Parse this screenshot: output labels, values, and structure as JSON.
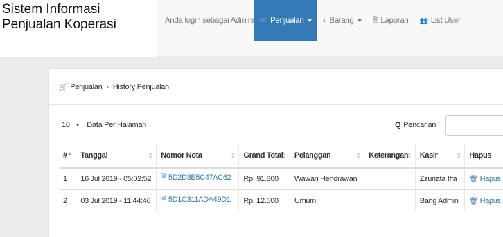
{
  "brand": "Sistem Informasi Penjualan Koperasi",
  "login_text": "Anda login sebagai Administrator",
  "menu": [
    {
      "label": "Penjualan",
      "icon": "cart-icon",
      "glyph": "🛒",
      "dropdown": true,
      "active": true
    },
    {
      "label": "Barang",
      "icon": "tag-icon",
      "glyph": "◐",
      "dropdown": true,
      "active": false
    },
    {
      "label": "Laporan",
      "icon": "file-icon",
      "glyph": "🗎",
      "dropdown": false,
      "active": false
    },
    {
      "label": "List User",
      "icon": "users-icon",
      "glyph": "👥",
      "dropdown": false,
      "active": false
    }
  ],
  "breadcrumb": {
    "root": "Penjualan",
    "current": "History Penjualan"
  },
  "per_page": {
    "value": "10",
    "label": "Data Per Halaman"
  },
  "search": {
    "label": "Pencarian :",
    "value": ""
  },
  "table": {
    "headers": [
      "#",
      "Tanggal",
      "Nomor Nota",
      "Grand Total",
      "Pelanggan",
      "Keterangan",
      "Kasir",
      "Hapus"
    ],
    "rows": [
      {
        "no": "1",
        "tanggal": "16 Jul 2019 - 05:02:52",
        "nota": "5D2D3E5C47AC62",
        "total": "Rp. 91.800",
        "pelanggan": "Wawan Hendrawan",
        "keterangan": "",
        "kasir": "Zzunata Iffa",
        "hapus": "Hapus"
      },
      {
        "no": "2",
        "tanggal": "03 Jul 2019 - 11:44:46",
        "nota": "5D1C311ADA49D1",
        "total": "Rp. 12.500",
        "pelanggan": "Umum",
        "keterangan": "",
        "kasir": "Bang Admin",
        "hapus": "Hapus"
      }
    ]
  },
  "colors": {
    "active_nav": "#337ab7",
    "link": "#337ab7"
  }
}
